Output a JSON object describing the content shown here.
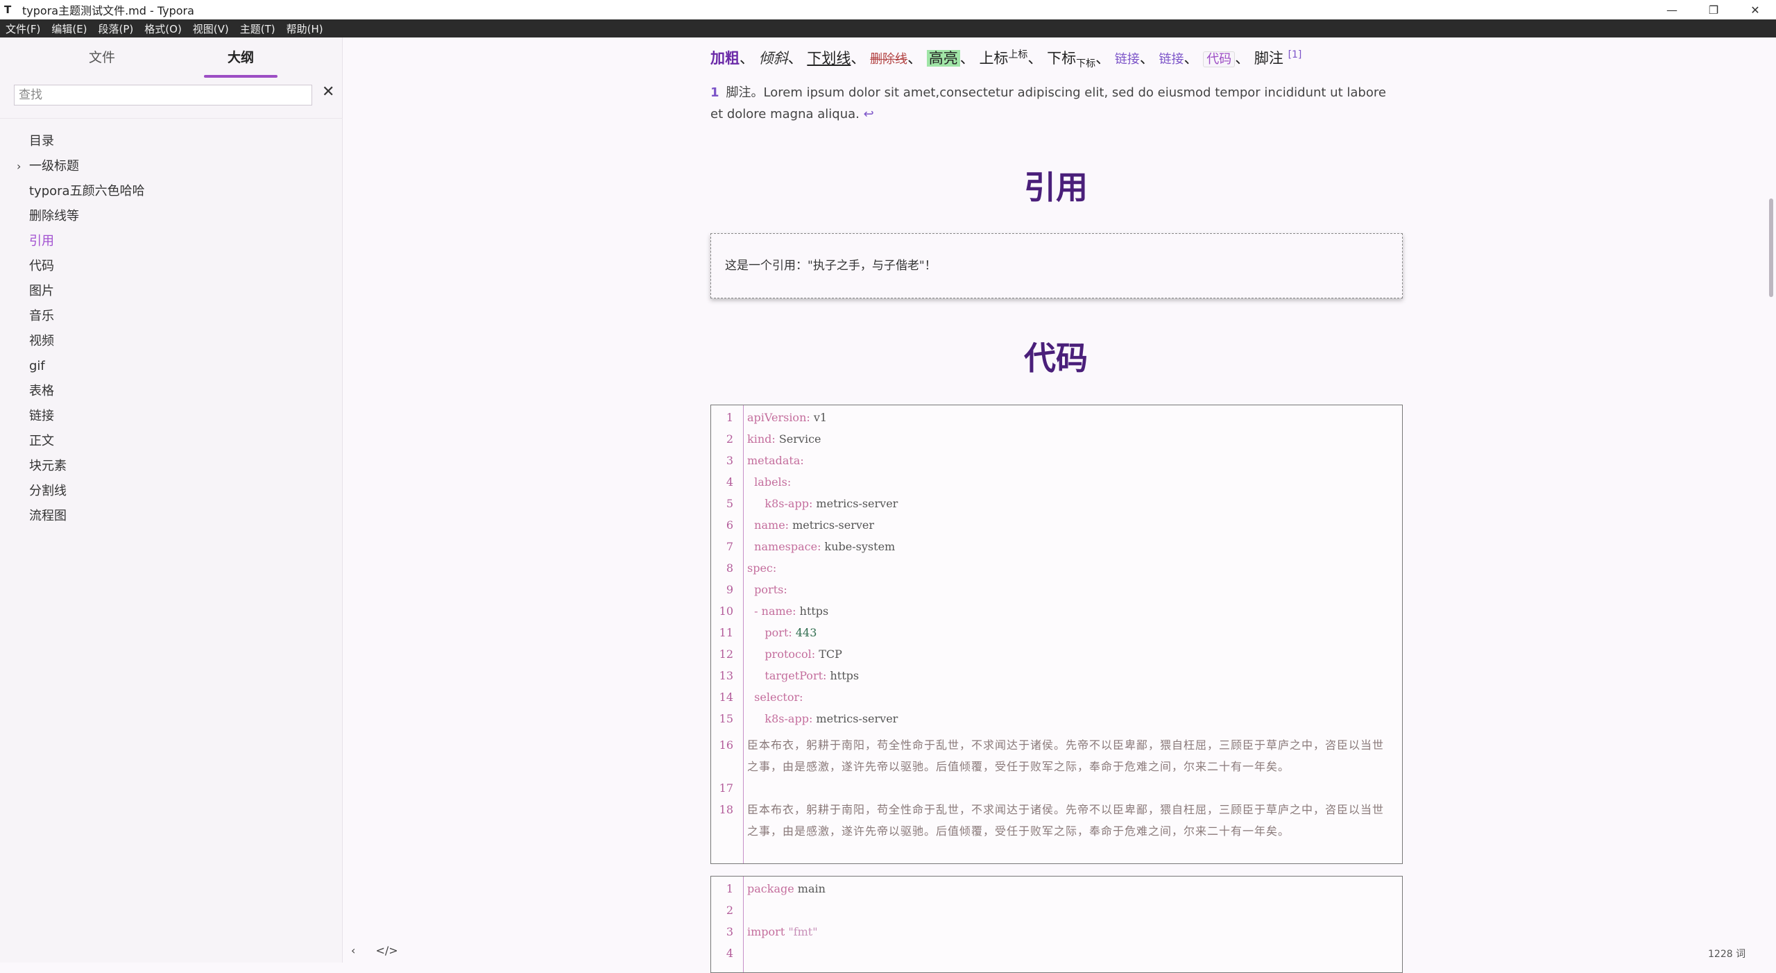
{
  "window": {
    "icon": "T",
    "title": "typora主题测试文件.md - Typora",
    "controls": [
      "—",
      "❐",
      "✕"
    ]
  },
  "menu": [
    "文件(F)",
    "编辑(E)",
    "段落(P)",
    "格式(O)",
    "视图(V)",
    "主题(T)",
    "帮助(H)"
  ],
  "sidebar": {
    "tab_files": "文件",
    "tab_outline": "大纲",
    "search_placeholder": "查找",
    "clear": "✕",
    "items": [
      {
        "label": "目录"
      },
      {
        "label": "一级标题",
        "chev": "›"
      },
      {
        "label": "typora五颜六色哈哈"
      },
      {
        "label": "删除线等"
      },
      {
        "label": "引用"
      },
      {
        "label": "代码"
      },
      {
        "label": "图片"
      },
      {
        "label": "音乐"
      },
      {
        "label": "视频"
      },
      {
        "label": "gif"
      },
      {
        "label": "表格"
      },
      {
        "label": "链接"
      },
      {
        "label": "正文"
      },
      {
        "label": "块元素"
      },
      {
        "label": "分割线"
      },
      {
        "label": "流程图"
      }
    ],
    "bottom_back": "‹",
    "bottom_source": "</>"
  },
  "editor": {
    "inline": {
      "bold": "加粗",
      "sep": "、",
      "italic": "倾斜",
      "underline": "下划线",
      "strike": "删除线",
      "highlight": "高亮",
      "sup_base": "上标",
      "sup": "上标",
      "sub_base": "下标",
      "sub": "下标",
      "link1": "链接",
      "link2": "链接",
      "code": "代码",
      "footnote_label": "脚注",
      "footnote_ref": "[1]"
    },
    "footnote": {
      "num": "1",
      "text": "脚注。Lorem ipsum dolor sit amet,consectetur adipiscing elit, sed do eiusmod tempor incididunt ut labore et dolore magna aliqua.",
      "back": "↩"
    },
    "h_quote": "引用",
    "quote_text": "这是一个引用：\"执子之手，与子偕老\"！",
    "h_code": "代码",
    "yaml_lines": [
      {
        "n": "1",
        "k": "apiVersion:",
        "v": " v1"
      },
      {
        "n": "2",
        "k": "kind:",
        "v": " Service"
      },
      {
        "n": "3",
        "k": "metadata:",
        "v": ""
      },
      {
        "n": "4",
        "k": "  labels:",
        "v": ""
      },
      {
        "n": "5",
        "k": "     k8s-app:",
        "v": " metrics-server"
      },
      {
        "n": "6",
        "k": "  name:",
        "v": " metrics-server"
      },
      {
        "n": "7",
        "k": "  namespace:",
        "v": " kube-system"
      },
      {
        "n": "8",
        "k": "spec:",
        "v": ""
      },
      {
        "n": "9",
        "k": "  ports:",
        "v": ""
      },
      {
        "n": "10",
        "k": "  - name:",
        "v": " https"
      },
      {
        "n": "11",
        "k": "     port:",
        "v": " 443",
        "num": true
      },
      {
        "n": "12",
        "k": "     protocol:",
        "v": " TCP"
      },
      {
        "n": "13",
        "k": "     targetPort:",
        "v": " https"
      },
      {
        "n": "14",
        "k": "  selector:",
        "v": ""
      },
      {
        "n": "15",
        "k": "     k8s-app:",
        "v": " metrics-server"
      }
    ],
    "yaml_cn_16": "臣本布衣，躬耕于南阳，苟全性命于乱世，不求闻达于诸侯。先帝不以臣卑鄙，猥自枉屈，三顾臣于草庐之中，咨臣以当世之事，由是感激，遂许先帝以驱驰。后值倾覆，受任于败军之际，奉命于危难之间，尔来二十有一年矣。",
    "yaml_n16": "16",
    "yaml_n17": "17",
    "yaml_n18": "18",
    "yaml_cn_18": "臣本布衣，躬耕于南阳，苟全性命于乱世，不求闻达于诸侯。先帝不以臣卑鄙，猥自枉屈，三顾臣于草庐之中，咨臣以当世之事，由是感激，遂许先帝以驱驰。后值倾覆，受任于败军之际，奉命于危难之间，尔来二十有一年矣。",
    "go_lines": [
      {
        "n": "1",
        "k": "package",
        "v": " main"
      },
      {
        "n": "2",
        "k": "",
        "v": ""
      },
      {
        "n": "3",
        "k": "import",
        "s": " \"fmt\""
      },
      {
        "n": "4",
        "k": "",
        "v": ""
      }
    ]
  },
  "status": {
    "word_count": "1228 词"
  }
}
